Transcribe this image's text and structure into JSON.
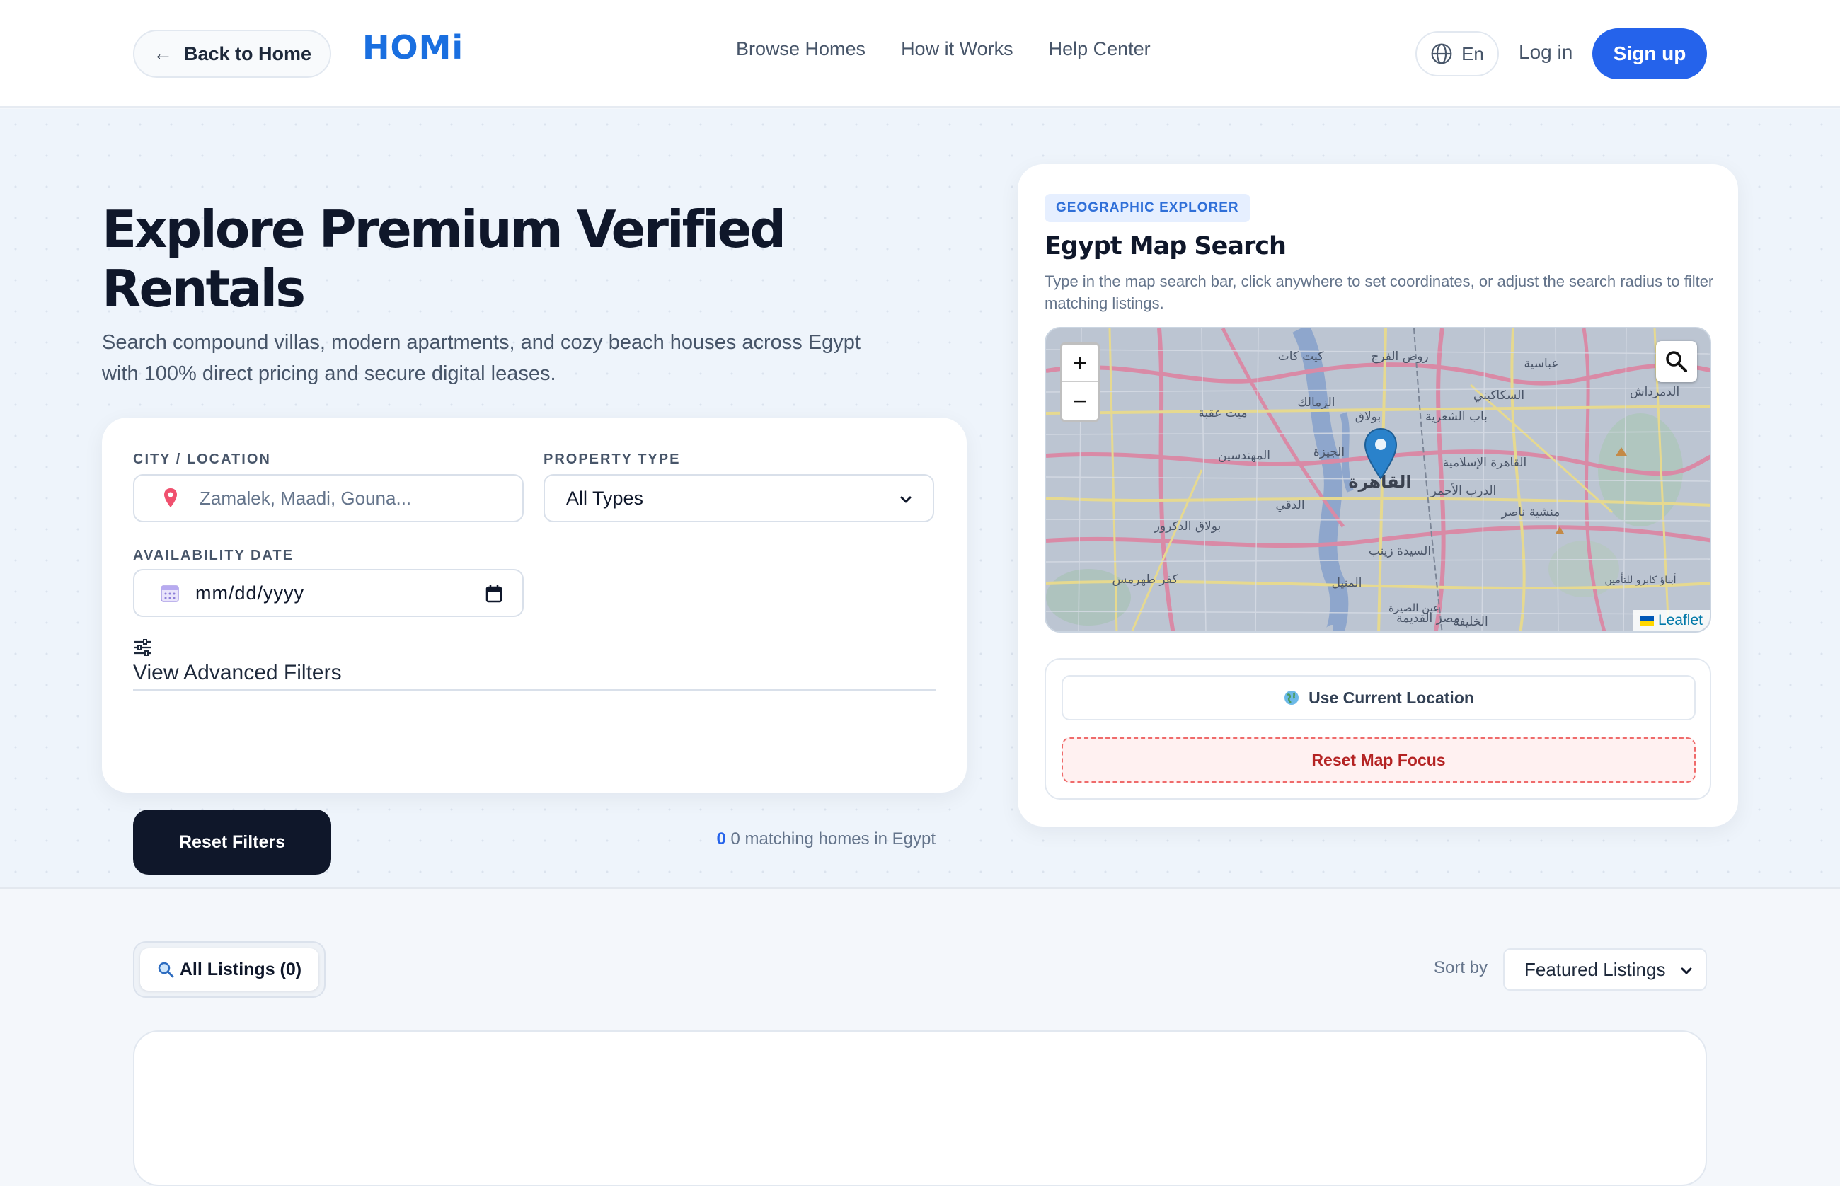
{
  "nav": {
    "back_label": "Back to Home",
    "logo": "HOMi",
    "links": [
      "Browse Homes",
      "How it Works",
      "Help Center"
    ],
    "lang": "En",
    "login": "Log in",
    "signup": "Sign up"
  },
  "hero": {
    "title": "Explore Premium Verified Rentals",
    "subtitle": "Search compound villas, modern apartments, and cozy beach houses across Egypt with 100% direct pricing and secure digital leases."
  },
  "filters": {
    "city_label": "CITY / LOCATION",
    "city_placeholder": "Zamalek, Maadi, Gouna...",
    "type_label": "PROPERTY TYPE",
    "type_value": "All Types",
    "date_label": "AVAILABILITY DATE",
    "date_value": "mm/dd/yyyy",
    "advanced_label": "View Advanced Filters",
    "reset_label": "Reset Filters",
    "match_count": "0",
    "match_text": "0 matching homes in Egypt"
  },
  "map": {
    "badge": "GEOGRAPHIC EXPLORER",
    "title": "Egypt Map Search",
    "description": "Type in the map search bar, click anywhere to set coordinates, or adjust the search radius to filter matching listings.",
    "zoom_in": "+",
    "zoom_out": "−",
    "attribution": "Leaflet",
    "use_location": "Use Current Location",
    "reset_focus": "Reset Map Focus",
    "place_labels": [
      "القاهرة",
      "الزمالك",
      "بولاق",
      "الدقي",
      "المهندسين",
      "السيدة زينب",
      "مصر القديمة",
      "عين الصيرة",
      "القاهرة الإسلامية",
      "باب الشعرية",
      "السكاكيني",
      "الدرب الأحمر",
      "منشية ناصر",
      "بولاق الدكرور",
      "كفر طهرمس",
      "الجيزة",
      "المنيل",
      "روض الفرج",
      "كيت كات",
      "ميت عقبة",
      "الخليفة",
      "أبناؤ كابرو للتأمين",
      "الدمرداش",
      "عباسية"
    ]
  },
  "listings": {
    "tab_label": "All Listings (0)",
    "sort_label": "Sort by",
    "sort_value": "Featured Listings"
  },
  "colors": {
    "primary": "#2563eb",
    "dark": "#0f172a",
    "danger": "#b42323",
    "badge_bg": "#e6efff"
  }
}
